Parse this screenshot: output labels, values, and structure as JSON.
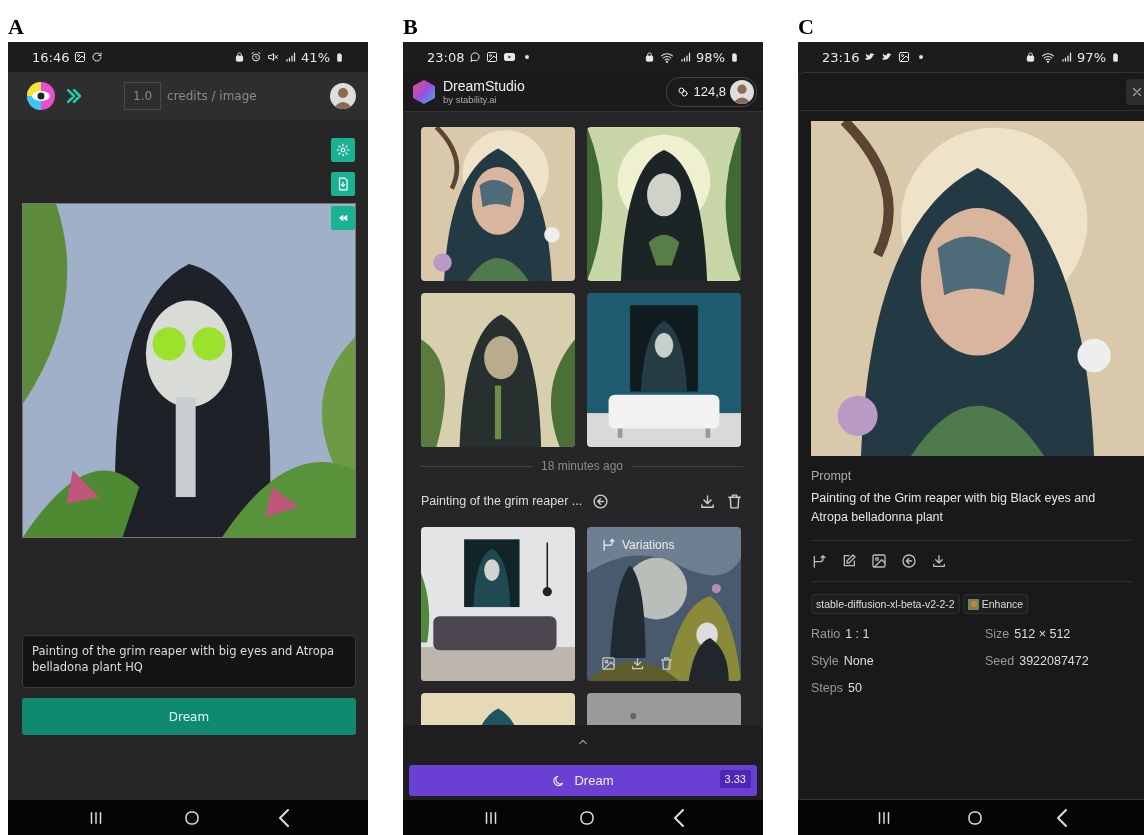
{
  "screen_a": {
    "label": "A",
    "status_bar": {
      "time": "16:46",
      "battery": "41%"
    },
    "header": {
      "credits_value": "1.0",
      "credits_label": "credits / image"
    },
    "prompt": {
      "value": "Painting of the grim reaper with big eyes and Atropa belladona plant HQ"
    },
    "dream_button": "Dream"
  },
  "screen_b": {
    "label": "B",
    "status_bar": {
      "time": "23:08",
      "battery": "98%"
    },
    "brand": {
      "name": "DreamStudio",
      "tagline": "by stability.ai"
    },
    "credits": "124,8",
    "divider_time": "18 minutes ago",
    "batch_title": "Painting of the grim reaper ...",
    "overlay_label": "Variations",
    "dream_button": {
      "label": "Dream",
      "cost": "3.33"
    }
  },
  "screen_c": {
    "label": "C",
    "status_bar": {
      "time": "23:16",
      "battery": "97%"
    },
    "prompt_label": "Prompt",
    "prompt": "Painting of the Grim reaper with big Black eyes and Atropa belladonna plant",
    "tags": [
      {
        "kind": "model",
        "label": "stable-diffusion-xl-beta-v2-2-2"
      },
      {
        "kind": "enhance",
        "label": "Enhance"
      }
    ],
    "params": [
      {
        "name": "Ratio",
        "value": "1 : 1"
      },
      {
        "name": "Size",
        "value": "512 × 512"
      },
      {
        "name": "Style",
        "value": "None"
      },
      {
        "name": "Seed",
        "value": "3922087472"
      },
      {
        "name": "Steps",
        "value": "50"
      }
    ]
  }
}
